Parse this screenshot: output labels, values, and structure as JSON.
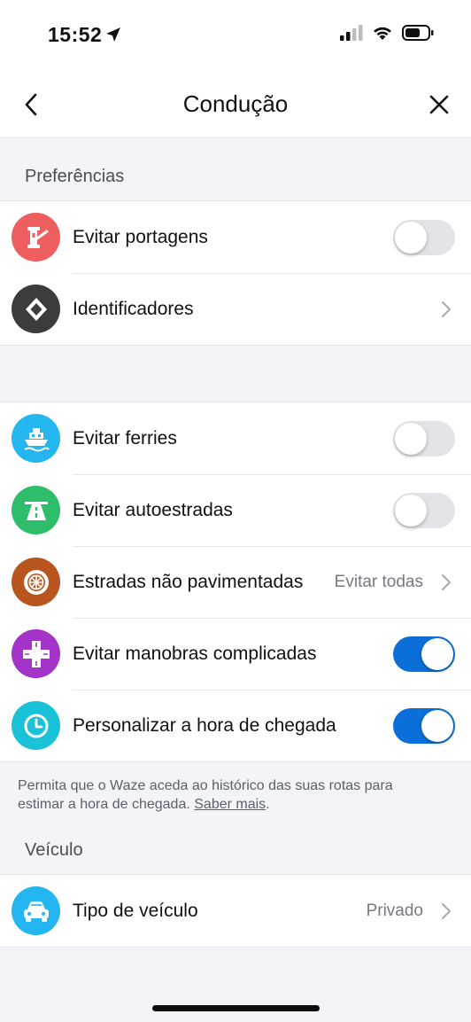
{
  "status_bar": {
    "time": "15:52"
  },
  "nav": {
    "title": "Condução"
  },
  "sections": {
    "preferences": "Preferências",
    "vehicle": "Veículo"
  },
  "group1": [
    {
      "label": "Evitar portagens",
      "icon": "toll-booth-icon",
      "color": "#ef5e5e",
      "toggle": false
    },
    {
      "label": "Identificadores",
      "icon": "diamond-icon",
      "color": "#3c3c3c"
    }
  ],
  "group2": [
    {
      "label": "Evitar ferries",
      "icon": "ferry-icon",
      "color": "#23b6f0",
      "toggle": false
    },
    {
      "label": "Evitar autoestradas",
      "icon": "highway-icon",
      "color": "#2ebd6b",
      "toggle": false
    },
    {
      "label": "Estradas não pavimentadas",
      "value": "Evitar todas",
      "icon": "wheel-icon",
      "color": "#b9561f"
    },
    {
      "label": "Evitar manobras complicadas",
      "icon": "intersection-icon",
      "color": "#a433c9",
      "toggle": true
    },
    {
      "label": "Personalizar a hora de chegada",
      "icon": "clock-icon",
      "color": "#19c2d6",
      "toggle": true
    }
  ],
  "footnote": {
    "text": "Permita que o Waze aceda ao histórico das suas rotas para estimar a hora de chegada.",
    "link": "Saber mais",
    "end": "."
  },
  "group3": [
    {
      "label": "Tipo de veículo",
      "value": "Privado",
      "icon": "car-icon",
      "color": "#23b6f0"
    }
  ],
  "colors": {
    "toggle_on": "#0a6fd8",
    "toggle_off": "#e3e4e7",
    "background": "#f2f4f8"
  }
}
